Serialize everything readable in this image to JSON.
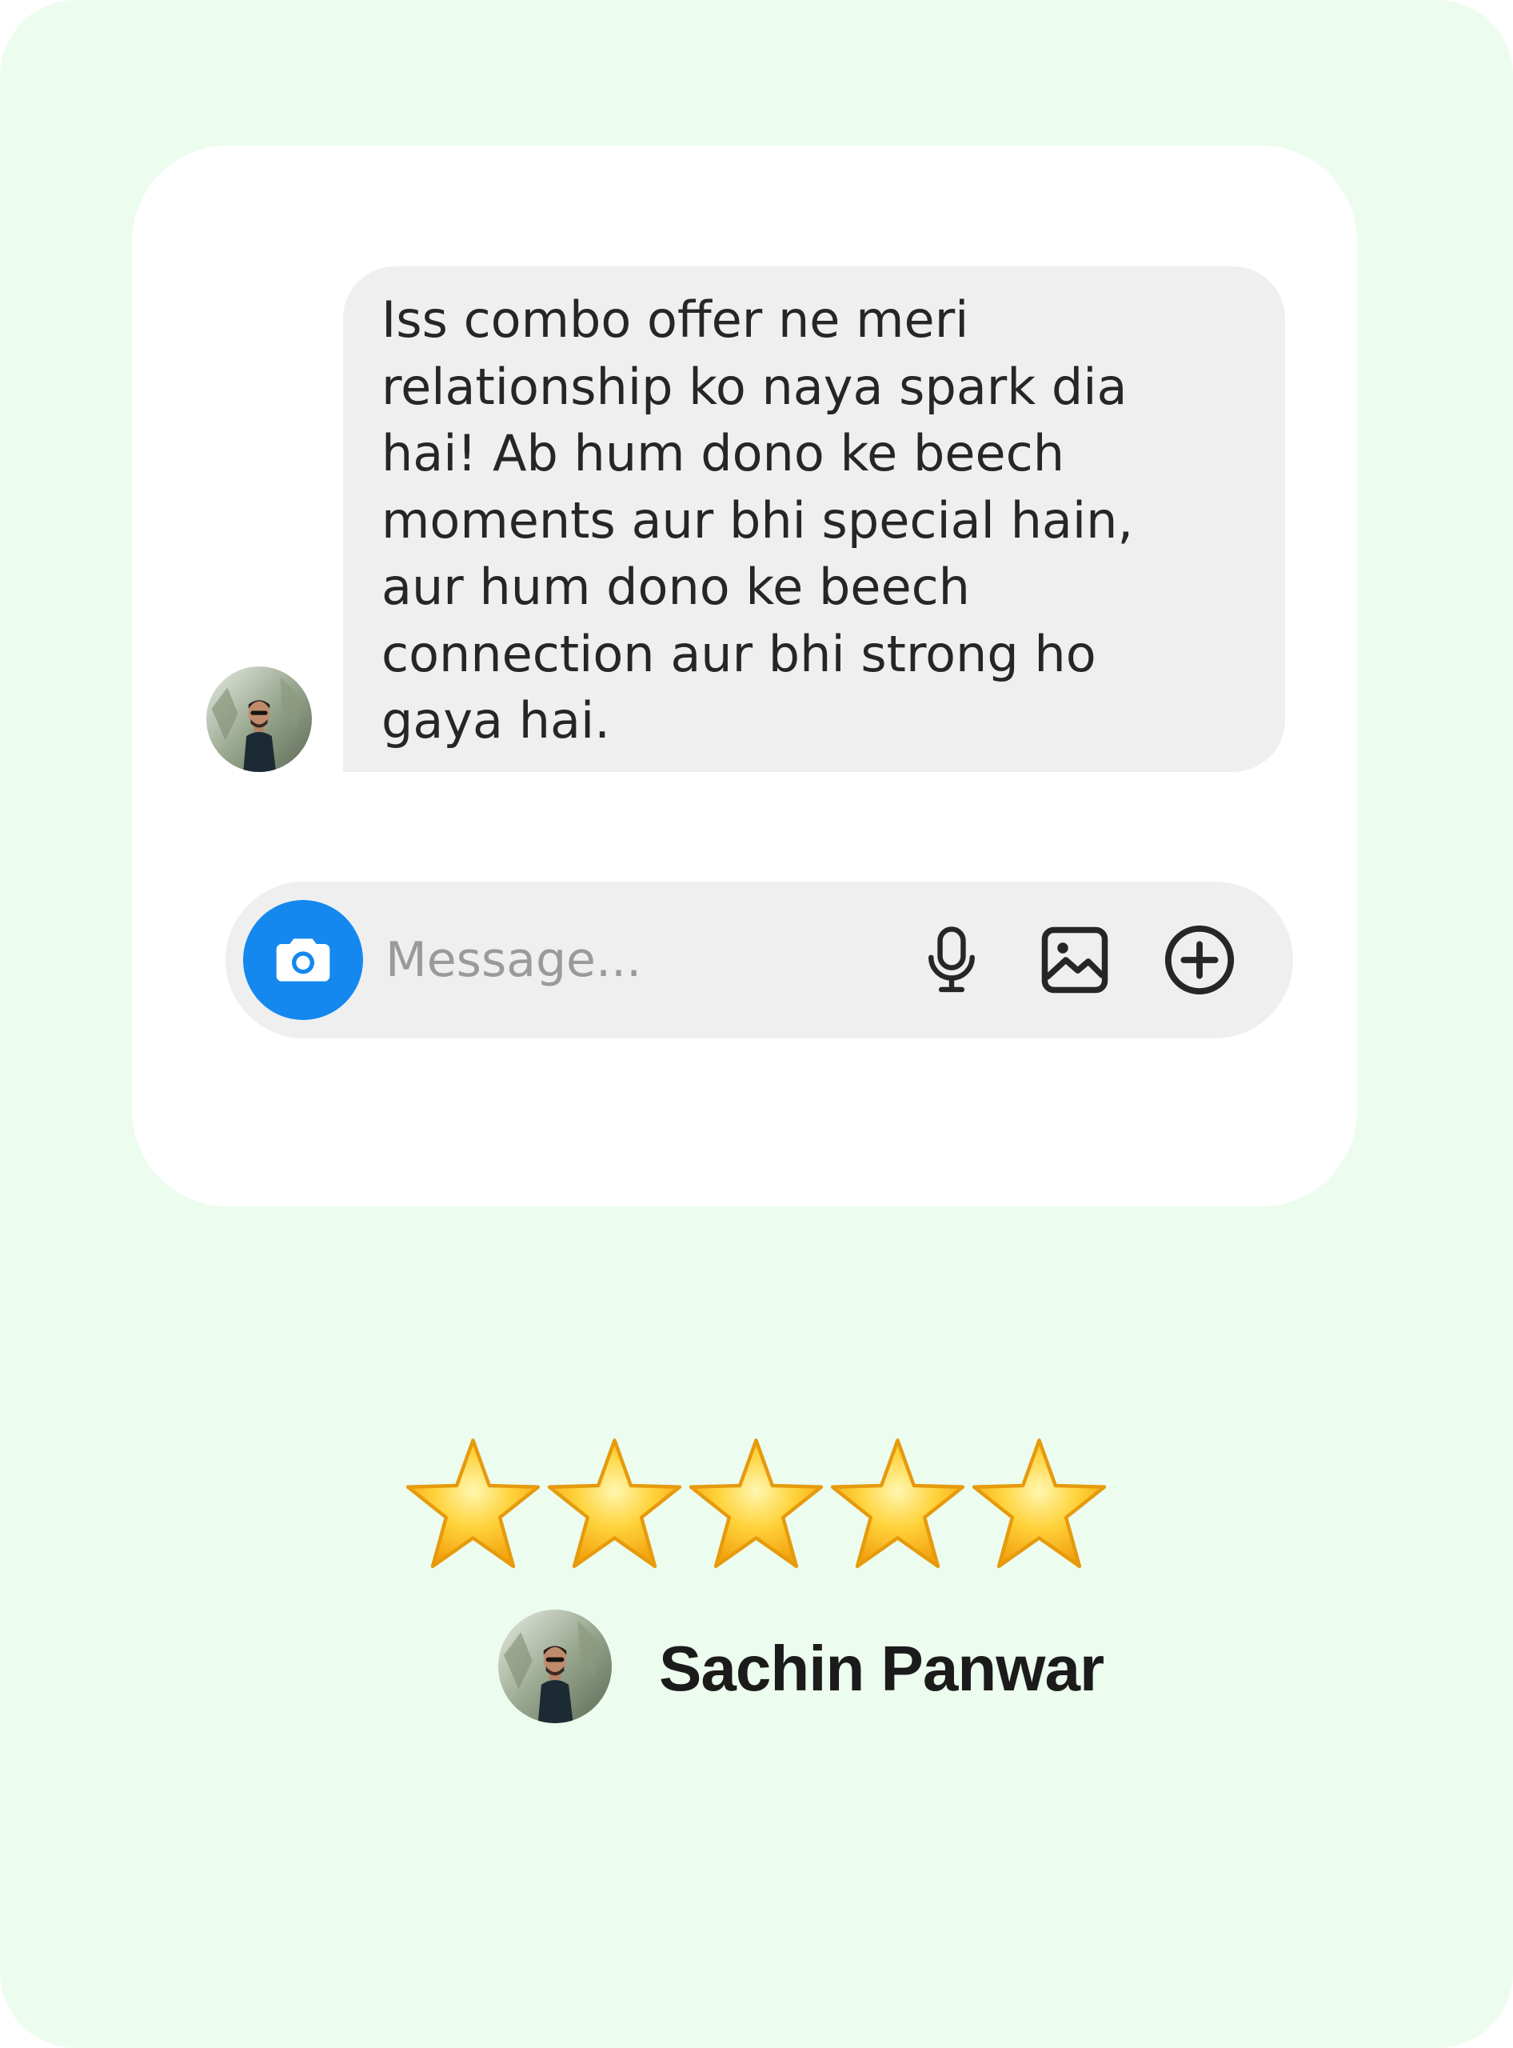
{
  "message": {
    "text": "Iss combo offer ne meri\nrelationship ko naya spark dia\nhai! Ab hum dono ke beech\nmoments aur bhi special hain,\naur hum dono ke beech\nconnection aur bhi strong ho\ngaya hai."
  },
  "composer": {
    "placeholder": "Message...",
    "icons": [
      "camera-icon",
      "microphone-icon",
      "image-icon",
      "plus-circle-icon"
    ]
  },
  "rating": {
    "stars": 5,
    "max": 5
  },
  "author": {
    "name": "Sachin Panwar"
  },
  "colors": {
    "background": "#ecfcee",
    "card": "#ffffff",
    "bubble": "#efefef",
    "camera_button": "#1488ee",
    "text": "#262626"
  }
}
